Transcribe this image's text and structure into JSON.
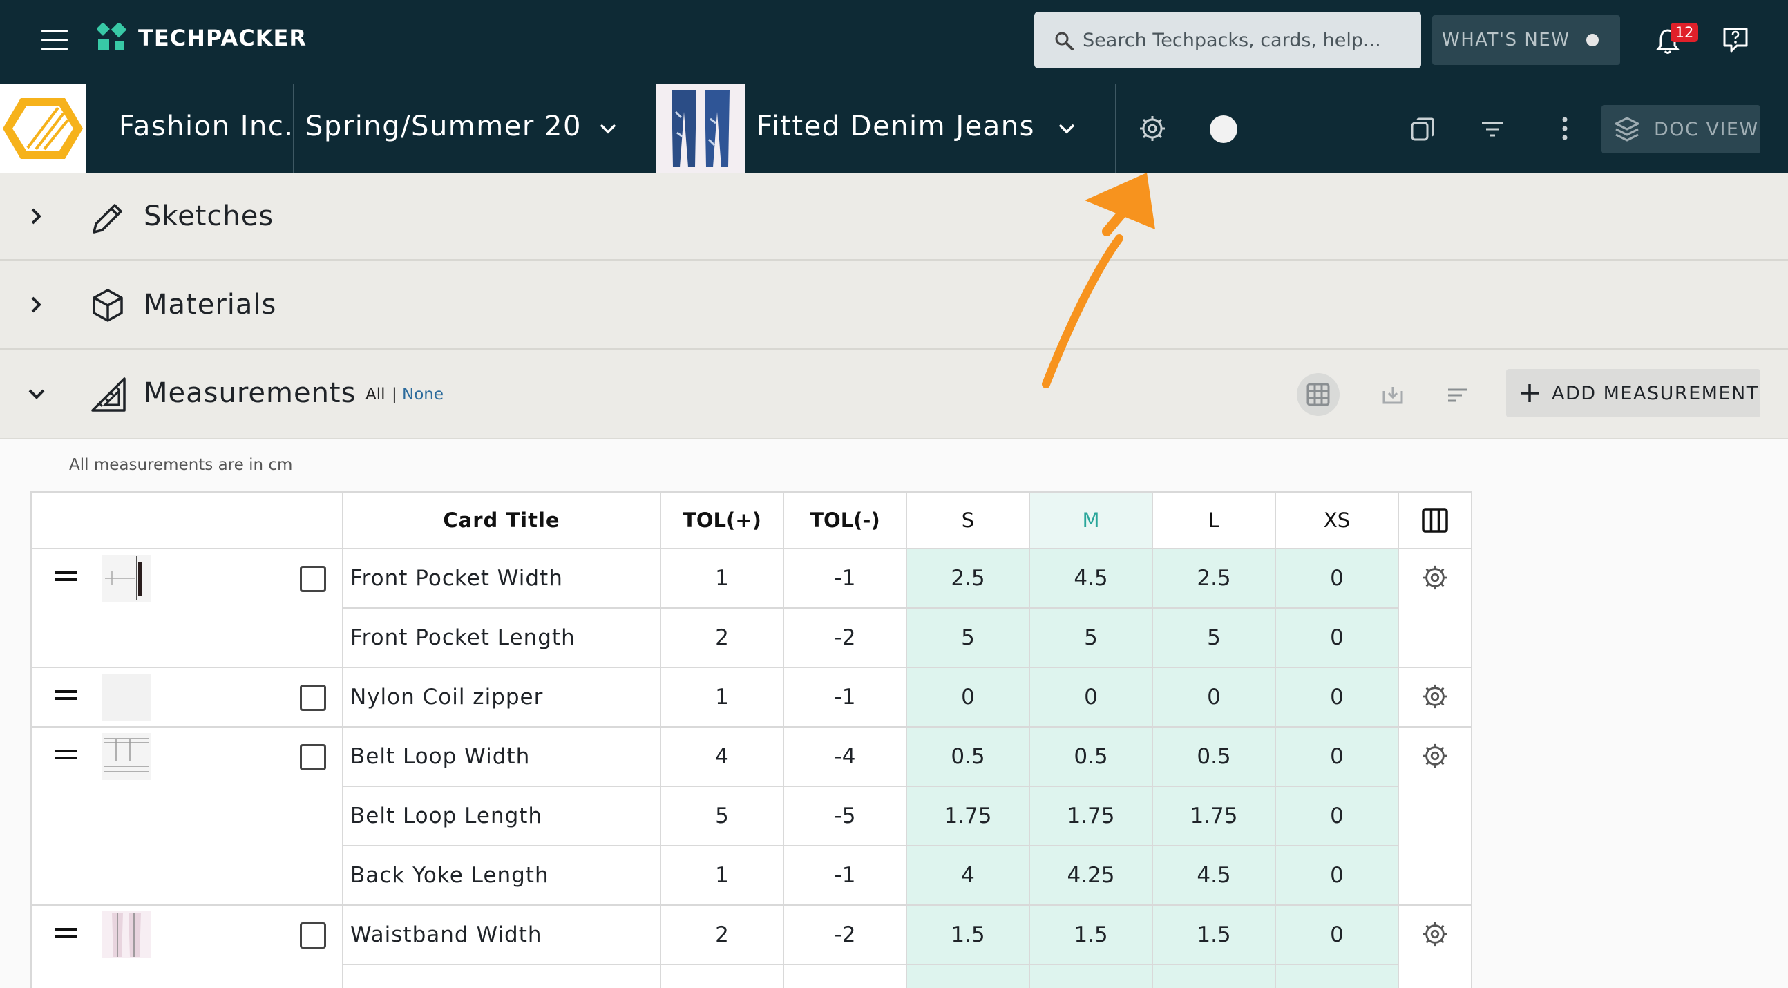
{
  "app": {
    "brand": "TECHPACKER"
  },
  "topbar": {
    "search_placeholder": "Search Techpacks, cards, help...",
    "whats_new_label": "WHAT'S NEW",
    "notification_count": "12"
  },
  "project": {
    "company": "Fashion Inc.",
    "season": "Spring/Summer 20",
    "product": "Fitted Denim Jeans",
    "doc_view_label": "DOC VIEW"
  },
  "sections": {
    "sketches": "Sketches",
    "materials": "Materials",
    "measurements": "Measurements",
    "select_all": "All",
    "select_sep": "|",
    "select_none": "None",
    "add_label": "ADD MEASUREMENT"
  },
  "measurements": {
    "units_note": "All measurements are in cm",
    "headers": {
      "title": "Card Title",
      "tol_plus": "TOL(+)",
      "tol_minus": "TOL(-)",
      "sizes": [
        "S",
        "M",
        "L",
        "XS"
      ]
    },
    "rows": [
      {
        "title": "Front Pocket Width",
        "tol_plus": "1",
        "tol_minus": "-1",
        "values": [
          "2.5",
          "4.5",
          "2.5",
          "0"
        ]
      },
      {
        "title": "Front Pocket Length",
        "tol_plus": "2",
        "tol_minus": "-2",
        "values": [
          "5",
          "5",
          "5",
          "0"
        ]
      },
      {
        "title": "Nylon Coil zipper",
        "tol_plus": "1",
        "tol_minus": "-1",
        "values": [
          "0",
          "0",
          "0",
          "0"
        ]
      },
      {
        "title": "Belt Loop Width",
        "tol_plus": "4",
        "tol_minus": "-4",
        "values": [
          "0.5",
          "0.5",
          "0.5",
          "0"
        ]
      },
      {
        "title": "Belt Loop Length",
        "tol_plus": "5",
        "tol_minus": "-5",
        "values": [
          "1.75",
          "1.75",
          "1.75",
          "0"
        ]
      },
      {
        "title": "Back Yoke Length",
        "tol_plus": "1",
        "tol_minus": "-1",
        "values": [
          "4",
          "4.25",
          "4.5",
          "0"
        ]
      },
      {
        "title": "Waistband Width",
        "tol_plus": "2",
        "tol_minus": "-2",
        "values": [
          "1.5",
          "1.5",
          "1.5",
          "0"
        ]
      }
    ]
  },
  "colors": {
    "header_bg": "#0e2a35",
    "accent_green": "#38c9a6",
    "size_cell_bg": "#def4ee",
    "annotation_arrow": "#f7931e",
    "badge_red": "#e0202a"
  },
  "icons": [
    "menu-icon",
    "techpacker-logo",
    "search-icon",
    "bell-icon",
    "help-icon",
    "chevron-down-icon",
    "gear-icon",
    "copy-icon",
    "filter-icon",
    "kebab-icon",
    "layers-icon",
    "chevron-right-icon",
    "pencil-icon",
    "cube-icon",
    "ruler-triangle-icon",
    "grid-icon",
    "download-icon",
    "sort-icon",
    "plus-icon",
    "drag-handle-icon",
    "columns-icon"
  ]
}
